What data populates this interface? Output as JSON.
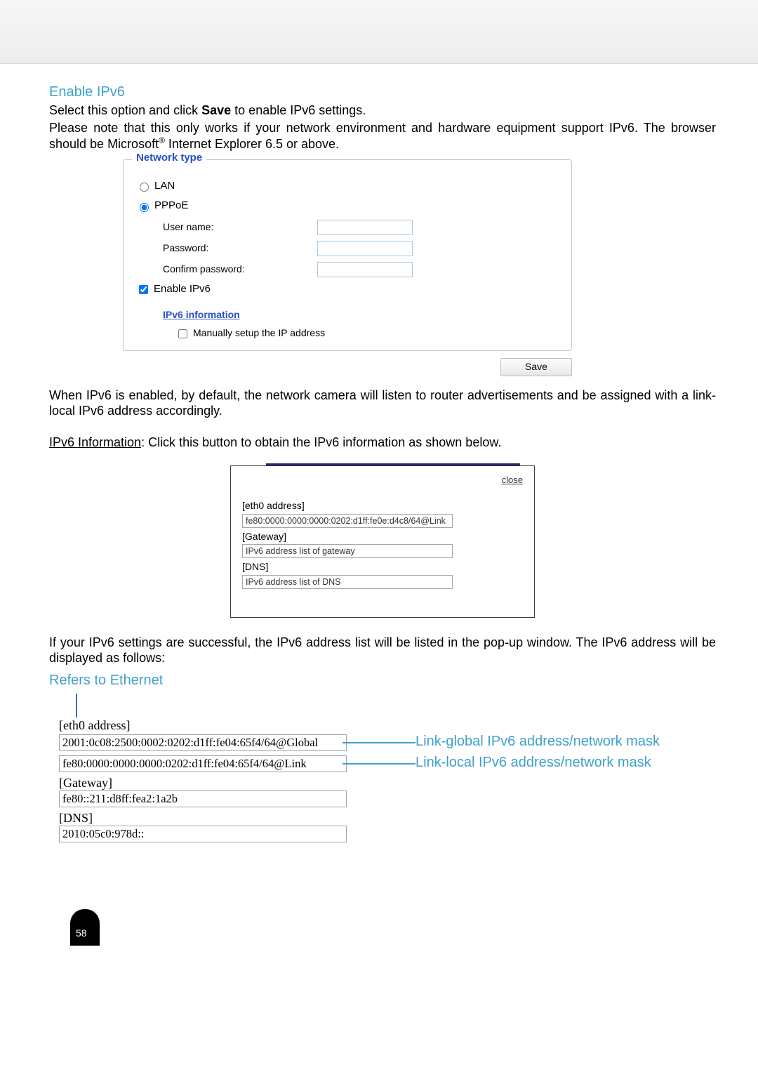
{
  "heading_enable_ipv6": "Enable IPv6",
  "intro": {
    "line1_a": "Select this option and click ",
    "line1_b": "Save",
    "line1_c": " to enable IPv6 settings.",
    "line2_a": "Please note that this only works if your network environment and hardware equipment support IPv6. The browser should be Microsoft",
    "line2_reg": "®",
    "line2_b": " Internet Explorer 6.5 or above."
  },
  "form": {
    "legend": "Network type",
    "lan_label": "LAN",
    "pppoe_label": "PPPoE",
    "user_name_label": "User name:",
    "password_label": "Password:",
    "confirm_password_label": "Confirm password:",
    "enable_ipv6_label": "Enable IPv6",
    "ipv6_info_link": "IPv6 information",
    "manual_label": "Manually setup the IP address",
    "save_button": "Save",
    "user_name_value": "",
    "password_value": "",
    "confirm_password_value": ""
  },
  "after_form_para": "When IPv6 is enabled, by default, the network camera will listen to router advertisements and be assigned with a link-local IPv6 address accordingly.",
  "ipv6_info_sentence_a": "IPv6 Information",
  "ipv6_info_sentence_b": ": Click this button to obtain the IPv6 information as shown below.",
  "popup": {
    "close": "close",
    "eth0_label": "[eth0 address]",
    "eth0_value": "fe80:0000:0000:0000:0202:d1ff:fe0e:d4c8/64@Link",
    "gateway_label": "[Gateway]",
    "gateway_value": "IPv6 address list of gateway",
    "dns_label": "[DNS]",
    "dns_value": "IPv6 address list of DNS"
  },
  "after_popup_para": "If your IPv6 settings are successful, the IPv6 address list will be listed in the pop-up window. The IPv6 address will be displayed as follows:",
  "refers_heading": "Refers to Ethernet",
  "annotated": {
    "eth0_label": "[eth0 address]",
    "global_addr": "2001:0c08:2500:0002:0202:d1ff:fe04:65f4/64@Global",
    "link_addr": "fe80:0000:0000:0000:0202:d1ff:fe04:65f4/64@Link",
    "gateway_label": "[Gateway]",
    "gateway_value": "fe80::211:d8ff:fea2:1a2b",
    "dns_label": "[DNS]",
    "dns_value": "2010:05c0:978d::",
    "callout_global": "Link-global IPv6 address/network mask",
    "callout_link": "Link-local IPv6 address/network mask"
  },
  "page_number": "58"
}
